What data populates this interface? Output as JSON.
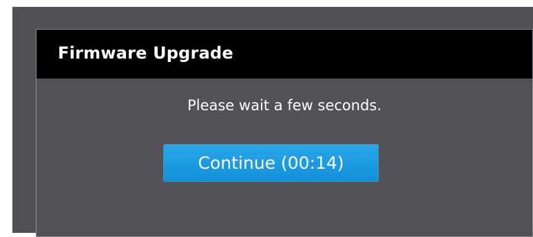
{
  "dialog": {
    "title": "Firmware Upgrade",
    "message": "Please wait a few seconds.",
    "continue_button_label": "Continue (00:14)"
  },
  "colors": {
    "page_background": "#4f5156",
    "header_background": "#000000",
    "button_background": "#1aa0e3",
    "text": "#ffffff"
  }
}
